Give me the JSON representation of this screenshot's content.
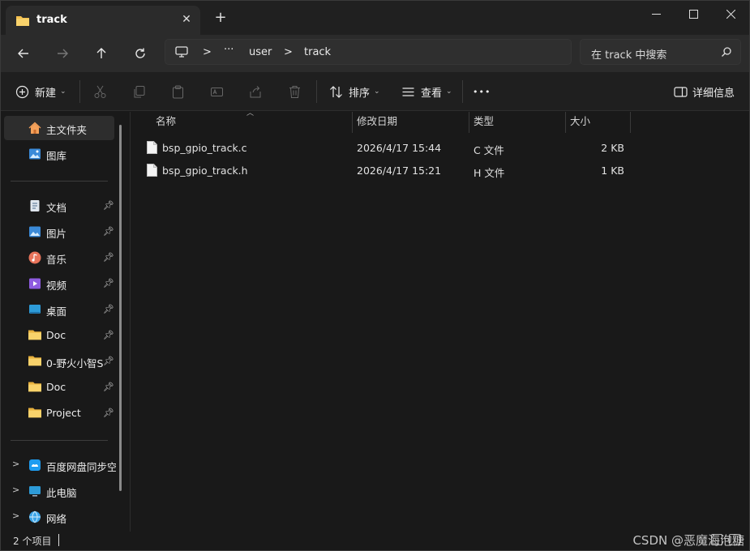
{
  "titlebar": {
    "tab_title": "track",
    "close_tab": "✕",
    "new_tab": "+"
  },
  "address": {
    "ellipsis": "···",
    "segments": [
      "user",
      "track"
    ],
    "separator": ">"
  },
  "search": {
    "placeholder": "在 track 中搜索"
  },
  "toolbar": {
    "new_label": "新建",
    "sort_label": "排序",
    "view_label": "查看",
    "more_label": "•••",
    "details_label": "详细信息"
  },
  "sidebar": {
    "home": "主文件夹",
    "gallery": "图库",
    "pinned": [
      {
        "label": "文档",
        "icon": "document-icon"
      },
      {
        "label": "图片",
        "icon": "pictures-icon"
      },
      {
        "label": "音乐",
        "icon": "music-icon"
      },
      {
        "label": "视频",
        "icon": "video-icon"
      },
      {
        "label": "桌面",
        "icon": "desktop-icon"
      },
      {
        "label": "Doc",
        "icon": "folder-icon"
      },
      {
        "label": "0-野火小智S",
        "icon": "folder-icon"
      },
      {
        "label": "Doc",
        "icon": "folder-icon"
      },
      {
        "label": "Project",
        "icon": "folder-icon"
      }
    ],
    "drives": [
      {
        "label": "百度网盘同步空",
        "icon": "cloud-drive-icon"
      },
      {
        "label": "此电脑",
        "icon": "pc-icon"
      },
      {
        "label": "网络",
        "icon": "network-icon"
      }
    ]
  },
  "columns": {
    "name": "名称",
    "date": "修改日期",
    "type": "类型",
    "size": "大小"
  },
  "files": [
    {
      "name": "bsp_gpio_track.c",
      "date": "2026/4/17 15:44",
      "type": "C 文件",
      "size": "2 KB"
    },
    {
      "name": "bsp_gpio_track.h",
      "date": "2026/4/17 15:21",
      "type": "H 文件",
      "size": "1 KB"
    }
  ],
  "status": {
    "item_count": "2 个项目",
    "watermark": "CSDN @恶魔海泡糖"
  },
  "colors": {
    "folder": "#f4c04f",
    "background": "#191919",
    "accent": "#4ea3ff"
  }
}
